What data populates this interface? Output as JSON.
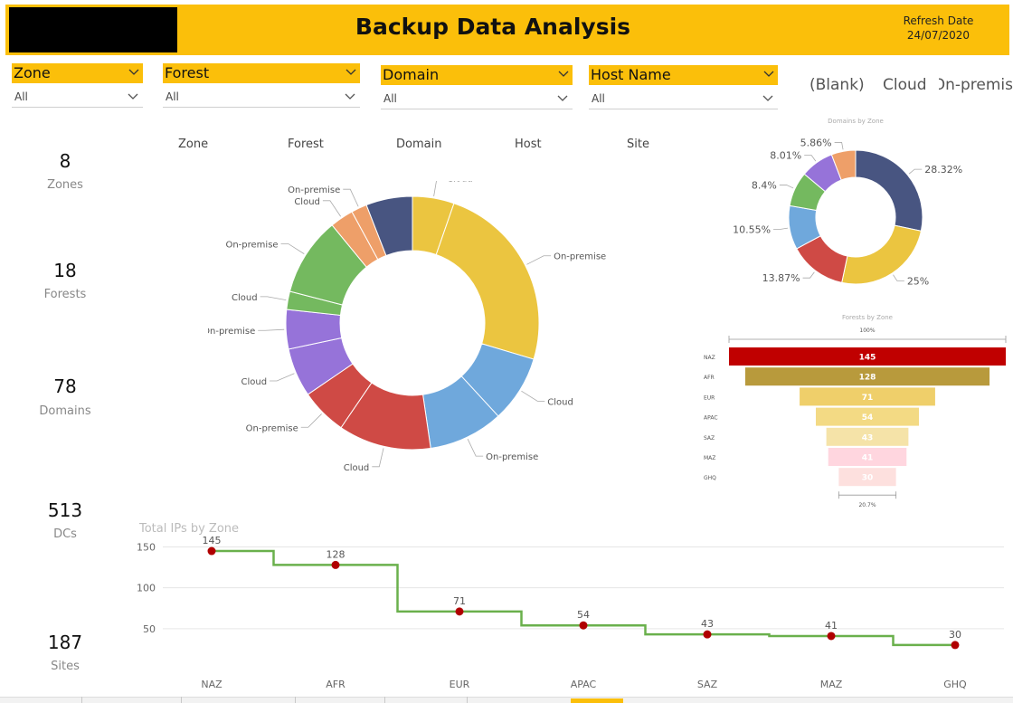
{
  "header": {
    "title": "Backup Data Analysis",
    "refresh_label": "Refresh Date",
    "refresh_date": "24/07/2020",
    "accent": "#fbbf0a"
  },
  "slicers": [
    {
      "label": "Zone",
      "value": "All"
    },
    {
      "label": "Forest",
      "value": "All"
    },
    {
      "label": "Domain",
      "value": "All"
    },
    {
      "label": "Host Name",
      "value": "All"
    }
  ],
  "type_buttons": [
    "(Blank)",
    "Cloud",
    "On-premis"
  ],
  "kpis": [
    {
      "value": "8",
      "label": "Zones"
    },
    {
      "value": "18",
      "label": "Forests"
    },
    {
      "value": "78",
      "label": "Domains"
    },
    {
      "value": "513",
      "label": "DCs"
    },
    {
      "value": "187",
      "label": "Sites"
    }
  ],
  "hierarchy_nav": [
    "Zone",
    "Forest",
    "Domain",
    "Host",
    "Site"
  ],
  "chart_data": [
    {
      "type": "pie",
      "variant": "donut",
      "title": "",
      "slices": [
        {
          "label": "Cloud",
          "value": 5.3,
          "color": "#ebc540"
        },
        {
          "label": "On-premise",
          "value": 24.2,
          "color": "#ebc540"
        },
        {
          "label": "Cloud",
          "value": 8.5,
          "color": "#6fa8dc"
        },
        {
          "label": "On-premise",
          "value": 9.5,
          "color": "#6fa8dc"
        },
        {
          "label": "Cloud",
          "value": 11.8,
          "color": "#cf4a45"
        },
        {
          "label": "On-premise",
          "value": 5.9,
          "color": "#cf4a45"
        },
        {
          "label": "Cloud",
          "value": 6.2,
          "color": "#9673d9"
        },
        {
          "label": "On-premise",
          "value": 5.0,
          "color": "#9673d9"
        },
        {
          "label": "Cloud",
          "value": 2.3,
          "color": "#74b95f"
        },
        {
          "label": "On-premise",
          "value": 10.0,
          "color": "#74b95f"
        },
        {
          "label": "Cloud",
          "value": 3.0,
          "color": "#ee9f69"
        },
        {
          "label": "On-premise",
          "value": 2.0,
          "color": "#ee9f69"
        },
        {
          "label": "",
          "value": 5.9,
          "color": "#485581"
        }
      ]
    },
    {
      "type": "pie",
      "variant": "donut",
      "title": "Domains by Zone",
      "slices": [
        {
          "label": "28.32%",
          "value": 28.32,
          "color": "#485581"
        },
        {
          "label": "25%",
          "value": 25.0,
          "color": "#ebc540"
        },
        {
          "label": "13.87%",
          "value": 13.87,
          "color": "#cf4a45"
        },
        {
          "label": "10.55%",
          "value": 10.55,
          "color": "#6fa8dc"
        },
        {
          "label": "8.4%",
          "value": 8.4,
          "color": "#74b95f"
        },
        {
          "label": "8.01%",
          "value": 8.01,
          "color": "#9673d9"
        },
        {
          "label": "5.86%",
          "value": 5.86,
          "color": "#ee9f69"
        }
      ]
    },
    {
      "type": "bar",
      "variant": "funnel",
      "title": "Forests by Zone",
      "top_label": "100%",
      "bottom_label": "20.7%",
      "categories": [
        "NAZ",
        "AFR",
        "EUR",
        "APAC",
        "SAZ",
        "MAZ",
        "GHQ"
      ],
      "values": [
        145,
        128,
        71,
        54,
        43,
        41,
        30
      ],
      "colors": [
        "#c00000",
        "#b89a3c",
        "#efcf6a",
        "#f3da84",
        "#f5e3a8",
        "#ffd6df",
        "#fde0de"
      ]
    },
    {
      "type": "line",
      "variant": "step",
      "title": "Total IPs by Zone",
      "categories": [
        "NAZ",
        "AFR",
        "EUR",
        "APAC",
        "SAZ",
        "MAZ",
        "GHQ"
      ],
      "values": [
        145,
        128,
        71,
        54,
        43,
        41,
        30
      ],
      "ylim": [
        0,
        155
      ],
      "yticks": [
        50,
        100,
        150
      ],
      "line_color": "#6ab04c",
      "marker_color": "#b00000",
      "grid": true
    }
  ]
}
